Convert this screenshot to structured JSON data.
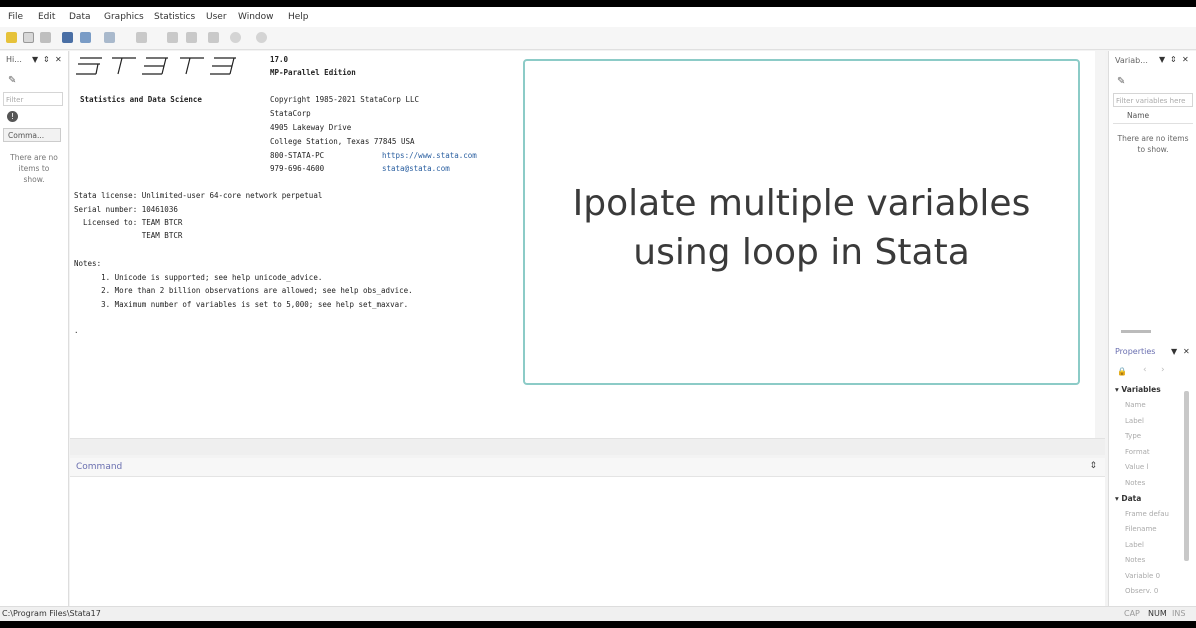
{
  "menu": [
    "File",
    "Edit",
    "Data",
    "Graphics",
    "Statistics",
    "User",
    "Window",
    "Help"
  ],
  "left_panel": {
    "title": "Hi...",
    "filter_placeholder": "Filter commands",
    "tab_label": "Comma...",
    "empty_text_lines": [
      "There are no",
      "items to",
      "show."
    ]
  },
  "results": {
    "version": "17.0",
    "edition": "MP-Parallel Edition",
    "tagline": "Statistics and Data Science",
    "copyright": "Copyright 1985-2021 StataCorp LLC",
    "company": "StataCorp",
    "address": "4905 Lakeway Drive",
    "city": "College Station, Texas 77845 USA",
    "phone": "800-STATA-PC",
    "url": "https://www.stata.com",
    "phone2": "979-696-4600",
    "email": "stata@stata.com",
    "license": "Stata license: Unlimited-user 64-core network perpetual",
    "serial": "Serial number: 10461036",
    "licensed_to_1": "  Licensed to: TEAM BTCR",
    "licensed_to_2": "               TEAM BTCR",
    "notes_label": "Notes:",
    "note_1": "      1. Unicode is supported; see help unicode_advice.",
    "note_2": "      2. More than 2 billion observations are allowed; see help obs_advice.",
    "note_3": "      3. Maximum number of variables is set to 5,000; see help set_maxvar.",
    "prompt": "."
  },
  "overlay": {
    "line_1": "Ipolate multiple variables",
    "line_2": "using loop in Stata"
  },
  "command": {
    "label": "Command"
  },
  "variables_panel": {
    "title": "Variab...",
    "filter_placeholder": "Filter variables here",
    "column_name": "Name",
    "empty_text_lines": [
      "There are no items",
      "to show."
    ]
  },
  "properties_panel": {
    "title": "Properties",
    "variables_header": "Variables",
    "variables_fields": [
      "Name",
      "Label",
      "Type",
      "Format",
      "Value l",
      "Notes"
    ],
    "data_header": "Data",
    "data_fields": [
      "Frame  defau",
      "Filename",
      "Label",
      "Notes",
      "Variable 0",
      "Observ. 0"
    ]
  },
  "statusbar": {
    "path": "C:\\Program Files\\Stata17",
    "cap": "CAP",
    "num": "NUM",
    "ins": "INS"
  },
  "colors": {
    "overlay_border": "#8ccbc7",
    "link": "#2a5fa0",
    "panel_title": "#6a6fb0"
  }
}
